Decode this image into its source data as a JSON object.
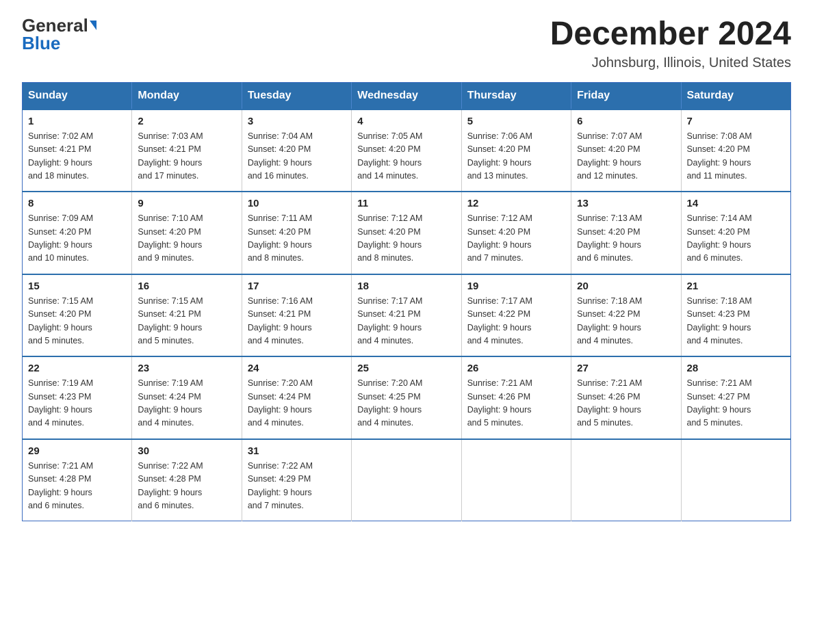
{
  "logo": {
    "general": "General",
    "blue": "Blue"
  },
  "header": {
    "month_year": "December 2024",
    "location": "Johnsburg, Illinois, United States"
  },
  "days_of_week": [
    "Sunday",
    "Monday",
    "Tuesday",
    "Wednesday",
    "Thursday",
    "Friday",
    "Saturday"
  ],
  "weeks": [
    [
      {
        "day": "1",
        "sunrise": "7:02 AM",
        "sunset": "4:21 PM",
        "daylight": "9 hours and 18 minutes."
      },
      {
        "day": "2",
        "sunrise": "7:03 AM",
        "sunset": "4:21 PM",
        "daylight": "9 hours and 17 minutes."
      },
      {
        "day": "3",
        "sunrise": "7:04 AM",
        "sunset": "4:20 PM",
        "daylight": "9 hours and 16 minutes."
      },
      {
        "day": "4",
        "sunrise": "7:05 AM",
        "sunset": "4:20 PM",
        "daylight": "9 hours and 14 minutes."
      },
      {
        "day": "5",
        "sunrise": "7:06 AM",
        "sunset": "4:20 PM",
        "daylight": "9 hours and 13 minutes."
      },
      {
        "day": "6",
        "sunrise": "7:07 AM",
        "sunset": "4:20 PM",
        "daylight": "9 hours and 12 minutes."
      },
      {
        "day": "7",
        "sunrise": "7:08 AM",
        "sunset": "4:20 PM",
        "daylight": "9 hours and 11 minutes."
      }
    ],
    [
      {
        "day": "8",
        "sunrise": "7:09 AM",
        "sunset": "4:20 PM",
        "daylight": "9 hours and 10 minutes."
      },
      {
        "day": "9",
        "sunrise": "7:10 AM",
        "sunset": "4:20 PM",
        "daylight": "9 hours and 9 minutes."
      },
      {
        "day": "10",
        "sunrise": "7:11 AM",
        "sunset": "4:20 PM",
        "daylight": "9 hours and 8 minutes."
      },
      {
        "day": "11",
        "sunrise": "7:12 AM",
        "sunset": "4:20 PM",
        "daylight": "9 hours and 8 minutes."
      },
      {
        "day": "12",
        "sunrise": "7:12 AM",
        "sunset": "4:20 PM",
        "daylight": "9 hours and 7 minutes."
      },
      {
        "day": "13",
        "sunrise": "7:13 AM",
        "sunset": "4:20 PM",
        "daylight": "9 hours and 6 minutes."
      },
      {
        "day": "14",
        "sunrise": "7:14 AM",
        "sunset": "4:20 PM",
        "daylight": "9 hours and 6 minutes."
      }
    ],
    [
      {
        "day": "15",
        "sunrise": "7:15 AM",
        "sunset": "4:20 PM",
        "daylight": "9 hours and 5 minutes."
      },
      {
        "day": "16",
        "sunrise": "7:15 AM",
        "sunset": "4:21 PM",
        "daylight": "9 hours and 5 minutes."
      },
      {
        "day": "17",
        "sunrise": "7:16 AM",
        "sunset": "4:21 PM",
        "daylight": "9 hours and 4 minutes."
      },
      {
        "day": "18",
        "sunrise": "7:17 AM",
        "sunset": "4:21 PM",
        "daylight": "9 hours and 4 minutes."
      },
      {
        "day": "19",
        "sunrise": "7:17 AM",
        "sunset": "4:22 PM",
        "daylight": "9 hours and 4 minutes."
      },
      {
        "day": "20",
        "sunrise": "7:18 AM",
        "sunset": "4:22 PM",
        "daylight": "9 hours and 4 minutes."
      },
      {
        "day": "21",
        "sunrise": "7:18 AM",
        "sunset": "4:23 PM",
        "daylight": "9 hours and 4 minutes."
      }
    ],
    [
      {
        "day": "22",
        "sunrise": "7:19 AM",
        "sunset": "4:23 PM",
        "daylight": "9 hours and 4 minutes."
      },
      {
        "day": "23",
        "sunrise": "7:19 AM",
        "sunset": "4:24 PM",
        "daylight": "9 hours and 4 minutes."
      },
      {
        "day": "24",
        "sunrise": "7:20 AM",
        "sunset": "4:24 PM",
        "daylight": "9 hours and 4 minutes."
      },
      {
        "day": "25",
        "sunrise": "7:20 AM",
        "sunset": "4:25 PM",
        "daylight": "9 hours and 4 minutes."
      },
      {
        "day": "26",
        "sunrise": "7:21 AM",
        "sunset": "4:26 PM",
        "daylight": "9 hours and 5 minutes."
      },
      {
        "day": "27",
        "sunrise": "7:21 AM",
        "sunset": "4:26 PM",
        "daylight": "9 hours and 5 minutes."
      },
      {
        "day": "28",
        "sunrise": "7:21 AM",
        "sunset": "4:27 PM",
        "daylight": "9 hours and 5 minutes."
      }
    ],
    [
      {
        "day": "29",
        "sunrise": "7:21 AM",
        "sunset": "4:28 PM",
        "daylight": "9 hours and 6 minutes."
      },
      {
        "day": "30",
        "sunrise": "7:22 AM",
        "sunset": "4:28 PM",
        "daylight": "9 hours and 6 minutes."
      },
      {
        "day": "31",
        "sunrise": "7:22 AM",
        "sunset": "4:29 PM",
        "daylight": "9 hours and 7 minutes."
      },
      null,
      null,
      null,
      null
    ]
  ],
  "labels": {
    "sunrise": "Sunrise:",
    "sunset": "Sunset:",
    "daylight": "Daylight:"
  }
}
